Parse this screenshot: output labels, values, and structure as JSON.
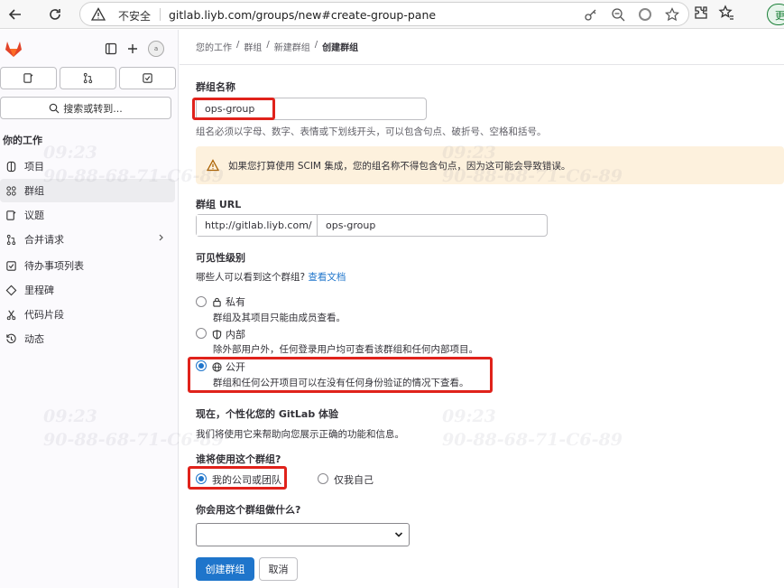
{
  "browser": {
    "insecure_label": "不安全",
    "url": "gitlab.liyb.com/groups/new#create-group-pane",
    "profile_initial": "更"
  },
  "sidebar": {
    "search_label": "搜索或转到...",
    "section_title": "你的工作",
    "avatar_alt": "a",
    "items": [
      {
        "label": "项目",
        "icon": "project-icon"
      },
      {
        "label": "群组",
        "icon": "group-icon"
      },
      {
        "label": "议题",
        "icon": "issues-icon"
      },
      {
        "label": "合并请求",
        "icon": "merge-request-icon"
      },
      {
        "label": "待办事项列表",
        "icon": "todo-icon"
      },
      {
        "label": "里程碑",
        "icon": "milestone-icon"
      },
      {
        "label": "代码片段",
        "icon": "snippet-icon"
      },
      {
        "label": "动态",
        "icon": "activity-icon"
      }
    ]
  },
  "breadcrumb": [
    "您的工作",
    "群组",
    "新建群组",
    "创建群组"
  ],
  "form": {
    "group_name_label": "群组名称",
    "group_name_value": "ops-group",
    "group_name_help": "组名必须以字母、数字、表情或下划线开头，可以包含句点、破折号、空格和括号。",
    "scim_warning": "如果您打算使用 SCIM 集成，您的组名称不得包含句点，因为这可能会导致错误。",
    "group_url_label": "群组 URL",
    "group_url_prefix": "http://gitlab.liyb.com/",
    "group_url_value": "ops-group",
    "visibility_label": "可见性级别",
    "visibility_help": "哪些人可以看到这个群组?",
    "visibility_doc_link": "查看文档",
    "visibility_options": [
      {
        "title": "私有",
        "desc": "群组及其项目只能由成员查看。",
        "icon": "lock-icon",
        "checked": false
      },
      {
        "title": "内部",
        "desc": "除外部用户外，任何登录用户均可查看该群组和任何内部项目。",
        "icon": "shield-icon",
        "checked": false
      },
      {
        "title": "公开",
        "desc": "群组和任何公开项目可以在没有任何身份验证的情况下查看。",
        "icon": "globe-icon",
        "checked": true
      }
    ],
    "personalize_title": "现在，个性化您的 GitLab 体验",
    "personalize_help": "我们将使用它来帮助向您展示正确的功能和信息。",
    "who_label": "谁将使用这个群组?",
    "who_options": [
      {
        "label": "我的公司或团队",
        "checked": true
      },
      {
        "label": "仅我自己",
        "checked": false
      }
    ],
    "purpose_label": "你会用这个群组做什么?",
    "purpose_value": "",
    "create_button": "创建群组",
    "cancel_button": "取消"
  },
  "watermark": {
    "time": "09:23",
    "mac": "90-88-68-71-C6-89"
  },
  "colors": {
    "primary": "#1f75cb",
    "highlight_box": "#e0221b",
    "warning_bg": "#fdf1dd"
  }
}
